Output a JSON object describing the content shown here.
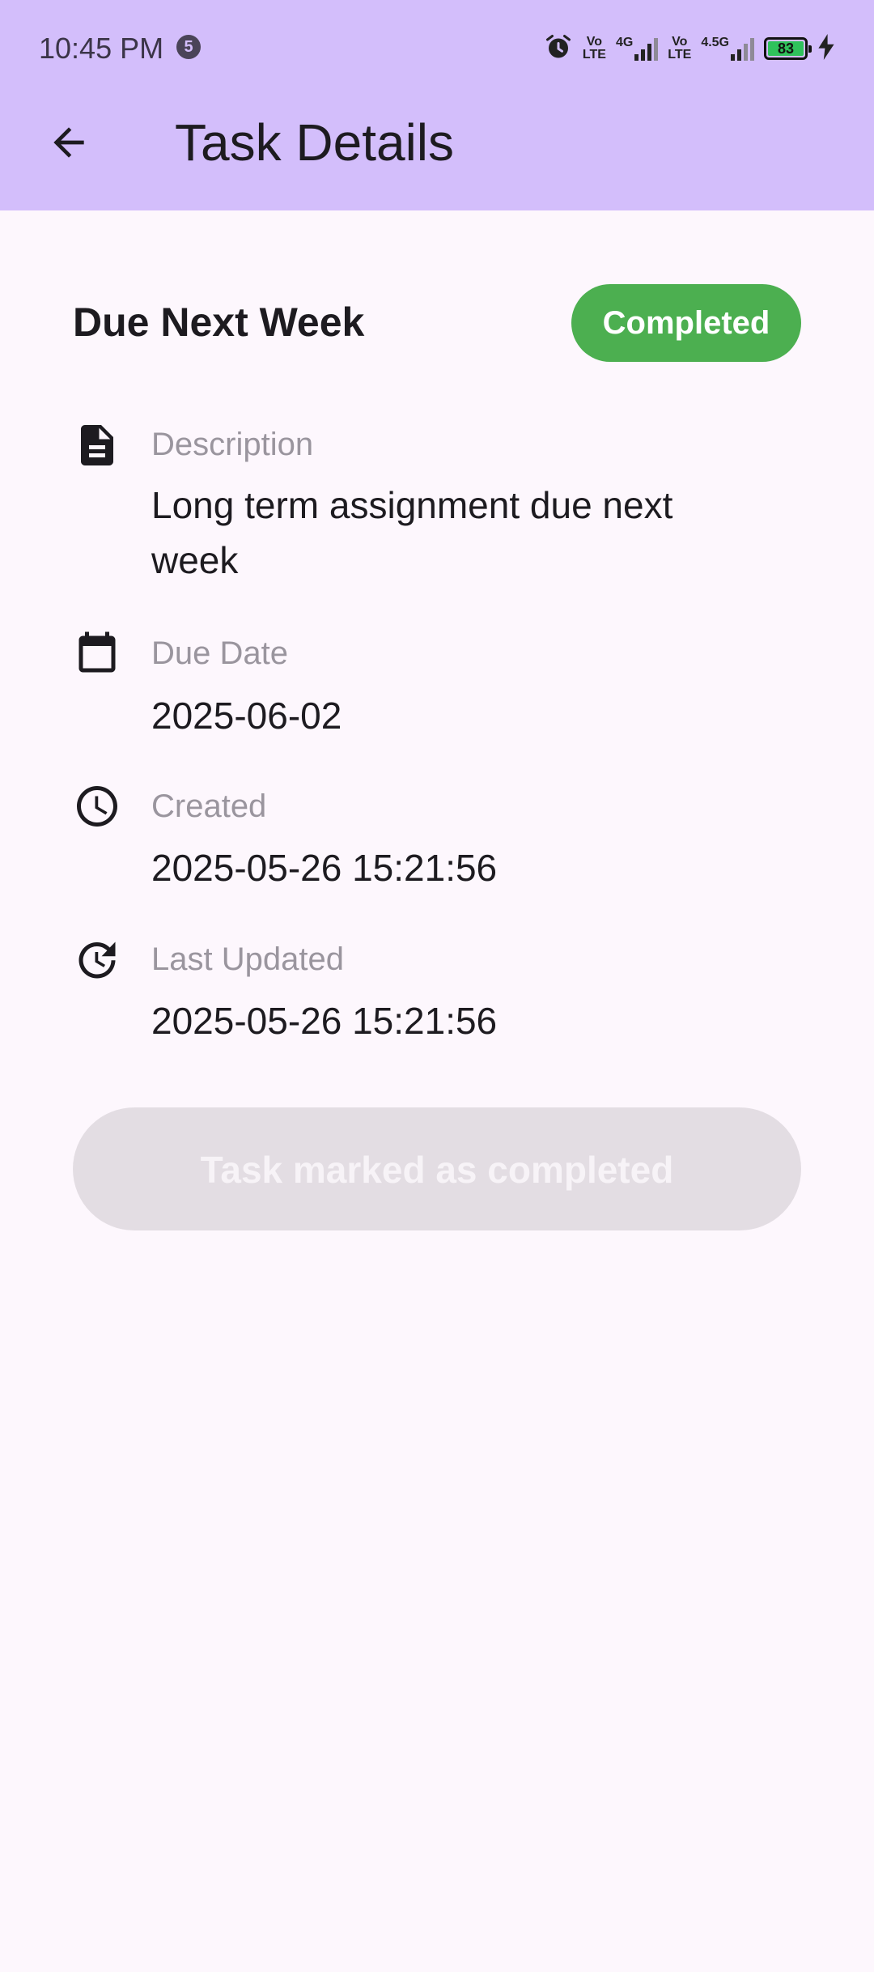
{
  "status_bar": {
    "time": "10:45 PM",
    "notification_count": "5",
    "network1_label_top": "Vo",
    "network1_label_bottom": "LTE",
    "network1_type": "4G",
    "network2_label_top": "Vo",
    "network2_label_bottom": "LTE",
    "network2_type": "4.5G",
    "battery_level": "83"
  },
  "app_bar": {
    "title": "Task Details"
  },
  "task": {
    "title": "Due Next Week",
    "status": "Completed",
    "status_color": "#4CAF50",
    "details": [
      {
        "icon": "description-icon",
        "label": "Description",
        "value": "Long term assignment due next week"
      },
      {
        "icon": "calendar-icon",
        "label": "Due Date",
        "value": "2025-06-02"
      },
      {
        "icon": "clock-icon",
        "label": "Created",
        "value": "2025-05-26 15:21:56"
      },
      {
        "icon": "update-icon",
        "label": "Last Updated",
        "value": "2025-05-26 15:21:56"
      }
    ]
  },
  "action_button": {
    "label": "Task marked as completed",
    "disabled": true
  },
  "colors": {
    "app_bar": "#D3BEFB",
    "background": "#FDF7FD",
    "disabled_button": "#E3DDE3"
  }
}
